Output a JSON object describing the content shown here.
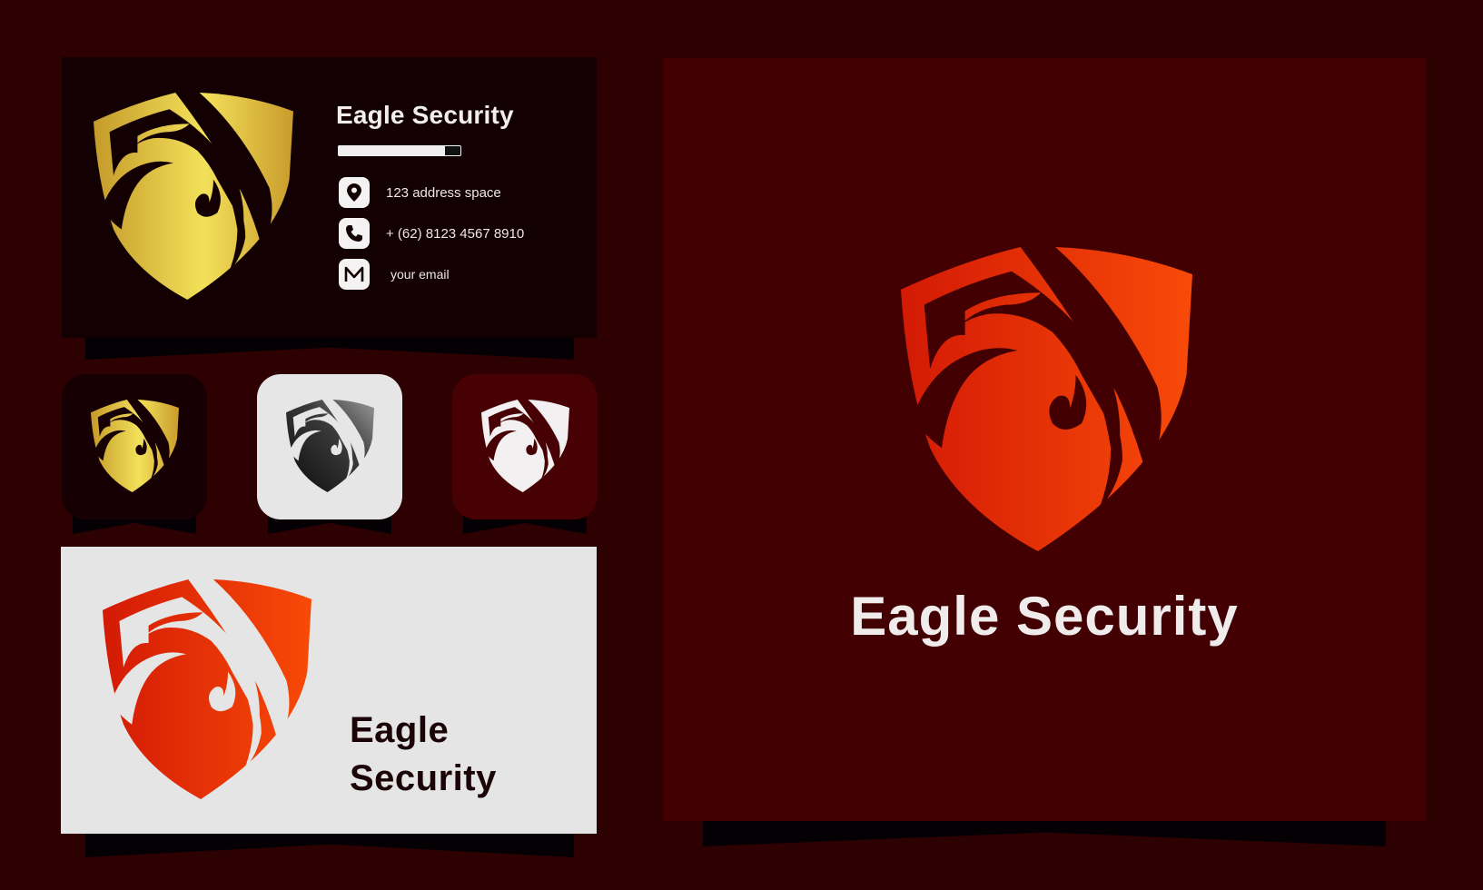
{
  "brand": {
    "name": "Eagle Security",
    "name_line1": "Eagle",
    "name_line2": "Security",
    "colors": {
      "page_background": "#2d0002",
      "panel_background": "#430003",
      "card_dark": "#130003",
      "card_light": "#e5e5e5",
      "gold_gradient": [
        "#c49a2a",
        "#f3e15a",
        "#c99b2c"
      ],
      "red_gradient": [
        "#d31a05",
        "#f24306"
      ],
      "gray_gradient": [
        "#111111",
        "#888888"
      ],
      "text_light": "#f0ecec",
      "text_dark": "#1a0407"
    }
  },
  "business_card": {
    "title": "Eagle Security",
    "progress_fraction": 0.87,
    "contacts": [
      {
        "icon": "location-pin-icon",
        "text": "123 address space"
      },
      {
        "icon": "phone-icon",
        "text": "+ (62) 8123 4567 8910"
      },
      {
        "icon": "mail-icon",
        "text": "your email"
      }
    ]
  },
  "app_icons": [
    {
      "variant": "gold",
      "background": "#160003"
    },
    {
      "variant": "gray",
      "background": "#e6e6e6"
    },
    {
      "variant": "white",
      "background": "#470004"
    }
  ],
  "light_card": {
    "title_line1": "Eagle",
    "title_line2": "Security"
  },
  "main_panel": {
    "title": "Eagle Security"
  }
}
